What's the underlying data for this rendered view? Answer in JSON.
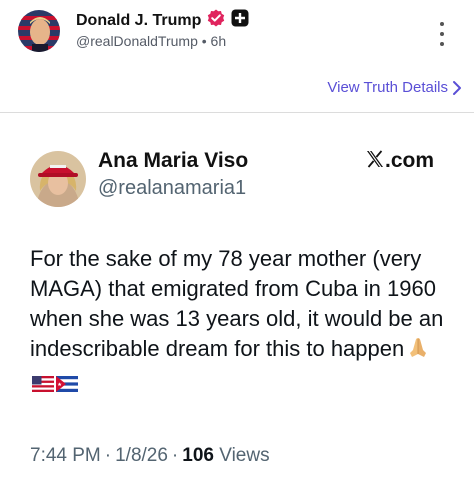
{
  "post": {
    "author_name": "Donald J. Trump",
    "handle": "@realDonaldTrump",
    "time_sep": "•",
    "time": "6h",
    "verified_icon": "verified-badge-icon",
    "follow_icon": "plus-icon",
    "more_icon": "more-vertical-icon",
    "view_details_label": "View Truth Details",
    "chevron_icon": "chevron-right-icon"
  },
  "quote": {
    "name": "Ana Maria Viso",
    "handle": "@realanamaria1",
    "brand": ".com",
    "brand_icon": "x-logo-icon",
    "body": "For the sake of my 78 year mother (very MAGA) that emigrated from Cuba in 1960 when she was 13 years old, it would be an indescribable dream for this to happen",
    "emojis": [
      "folded-hands-icon",
      "us-flag-icon",
      "cuba-flag-icon"
    ],
    "time": "7:44 PM",
    "date": "1/8/26",
    "views_count": "106",
    "views_label": "Views",
    "dot": "·"
  },
  "colors": {
    "link": "#5a4fd6",
    "verified": "#e0245e",
    "muted": "#536471"
  }
}
